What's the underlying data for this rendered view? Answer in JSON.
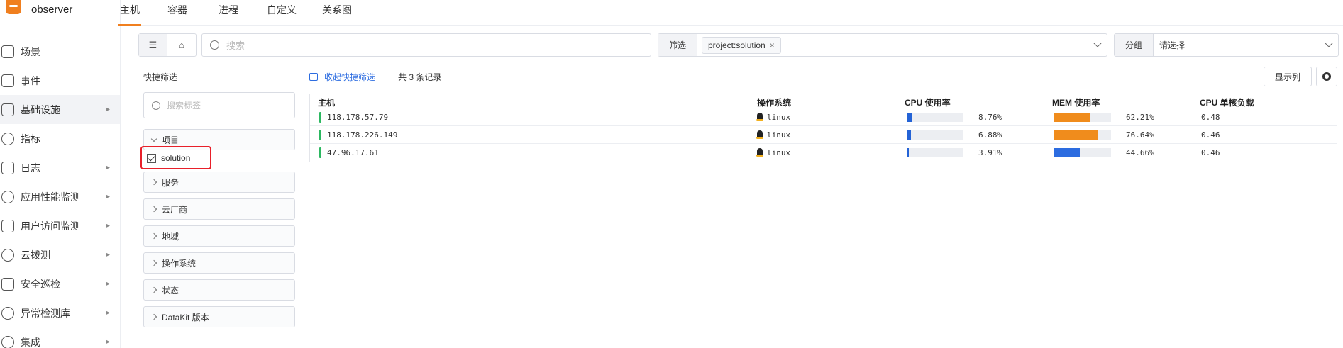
{
  "app": {
    "name": "observer"
  },
  "sidebar": {
    "items": [
      {
        "label": "场景",
        "icon": "monitor-icon",
        "has_arrow": false,
        "active": false
      },
      {
        "label": "事件",
        "icon": "flag-icon",
        "has_arrow": false,
        "active": false
      },
      {
        "label": "基础设施",
        "icon": "grid-icon",
        "has_arrow": true,
        "active": true
      },
      {
        "label": "指标",
        "icon": "target-icon",
        "has_arrow": false,
        "active": false
      },
      {
        "label": "日志",
        "icon": "document-icon",
        "has_arrow": true,
        "active": false
      },
      {
        "label": "应用性能监测",
        "icon": "gear-icon",
        "has_arrow": true,
        "active": false
      },
      {
        "label": "用户访问监测",
        "icon": "chart-icon",
        "has_arrow": true,
        "active": false
      },
      {
        "label": "云拨测",
        "icon": "signal-icon",
        "has_arrow": true,
        "active": false
      },
      {
        "label": "安全巡检",
        "icon": "shield-icon",
        "has_arrow": true,
        "active": false
      },
      {
        "label": "异常检测库",
        "icon": "alert-icon",
        "has_arrow": true,
        "active": false
      },
      {
        "label": "集成",
        "icon": "integration-icon",
        "has_arrow": true,
        "active": false
      }
    ]
  },
  "tabs": [
    "主机",
    "容器",
    "进程",
    "自定义",
    "关系图"
  ],
  "toolbar": {
    "search_placeholder": "搜索",
    "filter_label": "筛选",
    "filter_chip": "project:solution",
    "group_label": "分组",
    "group_value": "请选择"
  },
  "quick_filter": {
    "title": "快捷筛选",
    "search_placeholder": "搜索标签",
    "groups": [
      "项目",
      "服务",
      "云厂商",
      "地域",
      "操作系统",
      "状态",
      "DataKit 版本"
    ],
    "selected_option": "solution"
  },
  "list": {
    "collapse_label": "收起快捷筛选",
    "record_count": "共 3 条记录",
    "columns_button": "显示列",
    "headers": [
      "主机",
      "操作系统",
      "CPU 使用率",
      "MEM 使用率",
      "CPU 单核负载"
    ],
    "rows": [
      {
        "host": "118.178.57.79",
        "os": "linux",
        "cpu": "8.76%",
        "cpu_value": 8.76,
        "mem": "62.21%",
        "mem_value": 62.21,
        "load": "0.48"
      },
      {
        "host": "118.178.226.149",
        "os": "linux",
        "cpu": "6.88%",
        "cpu_value": 6.88,
        "mem": "76.64%",
        "mem_value": 76.64,
        "load": "0.46"
      },
      {
        "host": "47.96.17.61",
        "os": "linux",
        "cpu": "3.91%",
        "cpu_value": 3.91,
        "mem": "44.66%",
        "mem_value": 44.66,
        "load": "0.46"
      }
    ]
  },
  "colors": {
    "accent": "#f07f1f",
    "cpu_bar": "#2463d6",
    "mem_bar_high": "#f08c1c",
    "mem_bar_normal": "#2c6ce0",
    "status_ok": "#2cb861",
    "highlight_box": "#e8202a"
  }
}
